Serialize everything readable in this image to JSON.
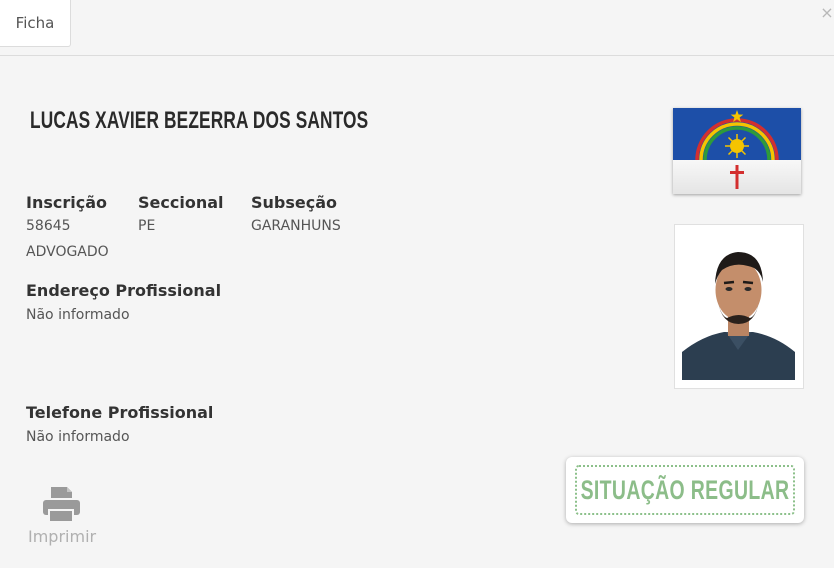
{
  "tab": {
    "label": "Ficha"
  },
  "close_label": "×",
  "profile": {
    "name": "LUCAS XAVIER BEZERRA DOS SANTOS",
    "inscricao_label": "Inscrição",
    "inscricao_value": "58645",
    "seccional_label": "Seccional",
    "seccional_value": "PE",
    "subsecao_label": "Subseção",
    "subsecao_value": "GARANHUNS",
    "tipo": "ADVOGADO",
    "endereco_label": "Endereço Profissional",
    "endereco_value": "Não informado",
    "telefone_label": "Telefone Profissional",
    "telefone_value": "Não informado"
  },
  "status": {
    "text": "SITUAÇÃO REGULAR",
    "color": "#8cbd89"
  },
  "actions": {
    "print_label": "Imprimir",
    "print_icon": "printer-icon"
  },
  "flag": {
    "name": "pernambuco-flag",
    "blue": "#1d4fa8",
    "red": "#c0392b"
  },
  "photo": {
    "name": "profile-photo"
  }
}
